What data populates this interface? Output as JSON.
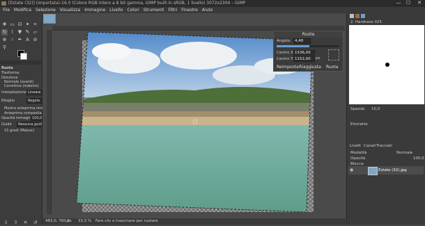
{
  "window": {
    "title": "[Estate (32)] (importata)-16.0 (Colore RGB intero a 8 bit gamma, GIMP built-in sRGB, 1 livello) 3072x2304 – GIMP",
    "minimize": "—",
    "maximize": "☐",
    "close": "✕"
  },
  "menu": [
    "File",
    "Modifica",
    "Selezione",
    "Visualizza",
    "Immagine",
    "Livello",
    "Colori",
    "Strumenti",
    "Filtri",
    "Finestre",
    "Aiuto"
  ],
  "tool_options": {
    "title": "Ruota",
    "transform_label": "Trasforma:",
    "direction_label": "Direzione",
    "direction_normal": "Normale (avanti)",
    "direction_corrective": "Correttiva (indietro)",
    "interpolation_label": "Interpolazione",
    "interpolation_value": "Lineare",
    "clipping_label": "Ritaglio",
    "clipping_value": "Regola",
    "show_preview": "Mostra anteprima immagi",
    "composite_preview": "Anteprima composita",
    "opacity_label": "Opacità immagine",
    "opacity_value": "100,0",
    "guides_label": "Guide",
    "guides_value": "Nessuna guida",
    "snap": "15 gradi (Maiusc)"
  },
  "rotate_dialog": {
    "title": "Ruota",
    "angle_label": "Angolo:",
    "angle_value": "4,48",
    "center_x_label": "Centro X:",
    "center_x_value": "1536,00",
    "center_y_label": "Centro Y:",
    "center_y_value": "1152,00",
    "unit": "px",
    "reset_button": "Reimposta",
    "readjust_button": "Riaggiusta",
    "rotate_button": "Ruota"
  },
  "status": {
    "coords": "483,0, 760,0",
    "unit": "px",
    "zoom": "33,3 %",
    "message": "Fare clic e trascinare per ruotare"
  },
  "brushes": {
    "header": "2. Hardness 025",
    "spacing_label": "Spaziat.",
    "spacing_value": "10,0",
    "tag_label": "Etichette"
  },
  "layers": {
    "tabs": [
      "Livelli",
      "Canali",
      "Tracciati"
    ],
    "mode_label": "Modalità",
    "mode_value": "Normale",
    "opacity_label": "Opacità",
    "opacity_value": "100,0",
    "lock_label": "Blocca:",
    "layer_name": "Estate (32).jpg"
  },
  "colors": {
    "accent": "#6a9fd4",
    "bg": "#454545"
  }
}
